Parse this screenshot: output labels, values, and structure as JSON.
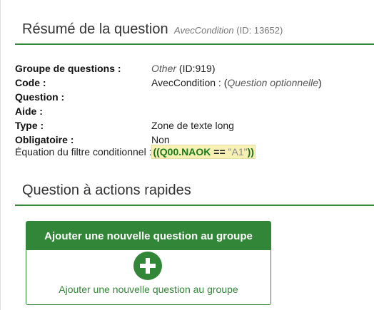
{
  "summary": {
    "title": "Résumé de la question",
    "question_code": "AvecCondition",
    "question_id": "(ID: 13652)"
  },
  "fields": {
    "group_label": "Groupe de questions :",
    "group_name": "Other",
    "group_id": "(ID:919)",
    "code_label": "Code :",
    "code_value": "AvecCondition : (",
    "code_optional": "Question optionnelle",
    "code_close": ")",
    "question_label": "Question :",
    "help_label": "Aide :",
    "type_label": "Type :",
    "type_value": "Zone de texte long",
    "mandatory_label": "Obligatoire :",
    "mandatory_value": "Non"
  },
  "equation": {
    "label": "Équation du filtre conditionnel :",
    "open": "((",
    "variable": "Q00.NAOK",
    "operator": " == ",
    "value": "\"A1\"",
    "close": "))"
  },
  "quick_actions": {
    "title": "Question à actions rapides",
    "panel_title": "Ajouter une nouvelle question au groupe",
    "link_label": "Ajouter une nouvelle question au groupe"
  },
  "colors": {
    "accent_green": "#328637",
    "highlight": "#f7f0b5"
  }
}
